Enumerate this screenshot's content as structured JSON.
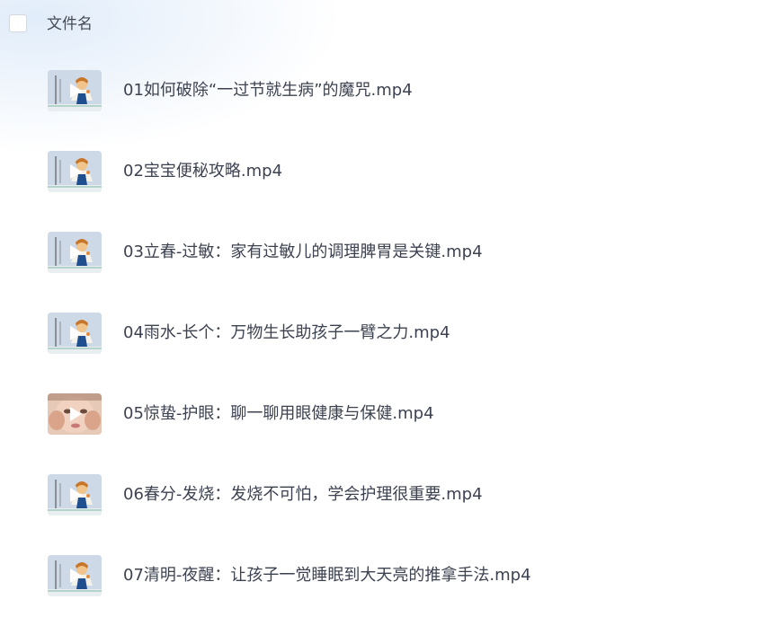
{
  "header": {
    "column_label": "文件名"
  },
  "files": [
    {
      "name": "01如何破除“一过节就生病”的魔咒.mp4",
      "thumbnail": "cartoon-doctor"
    },
    {
      "name": "02宝宝便秘攻略.mp4",
      "thumbnail": "cartoon-doctor"
    },
    {
      "name": "03立春-过敏：家有过敏儿的调理脾胃是关键.mp4",
      "thumbnail": "cartoon-doctor"
    },
    {
      "name": "04雨水-长个：万物生长助孩子一臂之力.mp4",
      "thumbnail": "cartoon-doctor"
    },
    {
      "name": "05惊蛰-护眼：聊一聊用眼健康与保健.mp4",
      "thumbnail": "child-face-photo"
    },
    {
      "name": "06春分-发烧：发烧不可怕，学会护理很重要.mp4",
      "thumbnail": "cartoon-doctor"
    },
    {
      "name": "07清明-夜醒：让孩子一觉睡眠到大天亮的推拿手法.mp4",
      "thumbnail": "cartoon-doctor"
    }
  ],
  "icons": {
    "play": "play-icon",
    "checkbox": "checkbox-icon"
  },
  "colors": {
    "text": "#3d4250",
    "checkbox_border": "#d4d8df",
    "thumb_bg": "#c9d6e5"
  }
}
